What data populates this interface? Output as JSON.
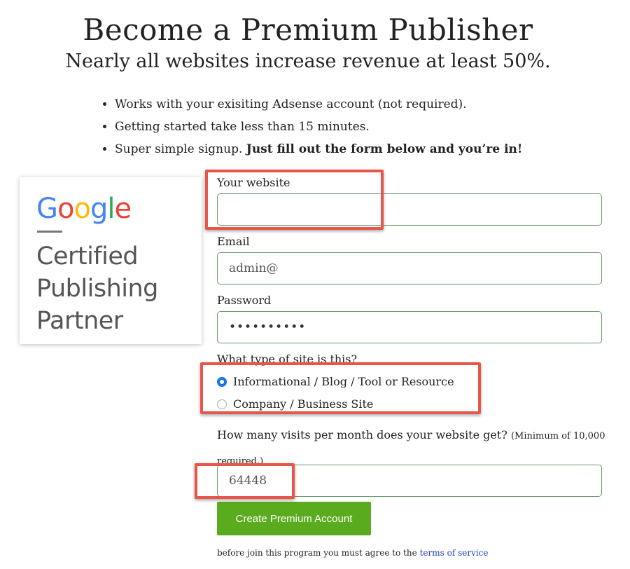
{
  "header": {
    "title": "Become a Premium Publisher",
    "subtitle": "Nearly all websites increase revenue at least 50%."
  },
  "benefits": [
    "Works with your exisiting Adsense account (not required).",
    "Getting started take less than 15 minutes.",
    "Super simple signup."
  ],
  "benefits_bold": "Just fill out the form below and you’re in!",
  "badge": {
    "logo_letters": [
      "G",
      "o",
      "o",
      "g",
      "l",
      "e"
    ],
    "logo_colors": [
      "#4285F4",
      "#EA4335",
      "#FBBC05",
      "#4285F4",
      "#34A853",
      "#EA4335"
    ],
    "lines": [
      "Certified",
      "Publishing",
      "Partner"
    ]
  },
  "form": {
    "website_label": "Your website",
    "website_value": "",
    "email_label": "Email",
    "email_value": "admin@",
    "password_label": "Password",
    "password_value": "••••••••••",
    "site_type_label": "What type of site is this?",
    "site_type_options": [
      {
        "label": "Informational / Blog / Tool or Resource",
        "selected": true
      },
      {
        "label": "Company / Business Site",
        "selected": false
      }
    ],
    "visits_label": "How many visits per month does your website get?",
    "visits_note": "(Minimum of 10,000 required.)",
    "visits_value": "64448",
    "submit_label": "Create Premium Account",
    "terms_text": "before join this program you must agree to the ",
    "terms_link": "terms of service"
  },
  "colors": {
    "submit": "#5aab1e",
    "highlight": "#e8564b",
    "link": "#1a3ec7",
    "field_border": "#6a9a6a"
  }
}
